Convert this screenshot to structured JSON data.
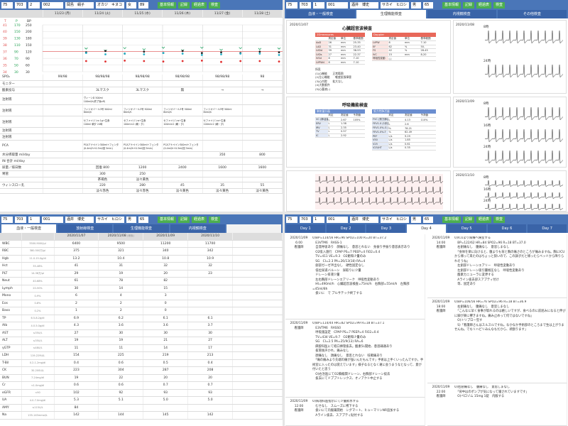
{
  "q1": {
    "pt": [
      "75",
      "703",
      "2",
      "002",
      "岡島　絹子",
      "オカジ　キヌコ",
      "女",
      "89"
    ],
    "btns": [
      "基本情報",
      "記録",
      "経過表",
      "検査"
    ],
    "dates": [
      "11/23 (月)",
      "11/24 (火)",
      "11/25 (水)",
      "11/26 (木)",
      "11/27 (金)",
      "11/28 (土)"
    ],
    "axis": {
      "heads": [
        "T",
        "P",
        "BP"
      ],
      "rows": [
        [
          "41",
          "170",
          "250"
        ],
        [
          "40",
          "150",
          "200"
        ],
        [
          "39",
          "130",
          "180"
        ],
        [
          "38",
          "110",
          "150"
        ],
        [
          "37",
          "90",
          "120"
        ],
        [
          "36",
          "70",
          "90"
        ],
        [
          "35",
          "50",
          "60"
        ],
        [
          "34",
          "30",
          "30"
        ]
      ]
    },
    "vitals": {
      "temp": [
        36.8,
        36.6,
        36.7,
        36.6,
        36.8,
        36.7,
        36.5,
        36.6,
        36.7,
        36.7,
        36.5
      ],
      "pulse": [
        88,
        92,
        84,
        90,
        86,
        92,
        86,
        88,
        86,
        90,
        88
      ],
      "bp_sys": [
        136,
        126,
        138,
        132,
        140,
        128,
        140,
        130,
        138,
        134,
        136
      ],
      "bp_dia": [
        80,
        78,
        82,
        80,
        78,
        80,
        82,
        76,
        80,
        80,
        78
      ]
    },
    "rows": [
      {
        "label": "SPO₂",
        "cells": [
          "99/98",
          "98/98/98",
          "98/98/98",
          "98/98/98",
          "98/98/98",
          "98"
        ]
      },
      {
        "label": "モニター",
        "cells": [
          "",
          "",
          "",
          "",
          "",
          ""
        ]
      },
      {
        "label": "酸素投与",
        "cells": [
          "",
          "3Lマスク",
          "3Lマスク",
          "無",
          "→",
          "→"
        ]
      },
      {
        "label": "注射液",
        "cells": [
          "",
          "ヴィーンD 500ml\n100ml/h(終了後off)",
          "",
          "",
          "",
          ""
        ]
      },
      {
        "label": "注射液",
        "cells": [
          "",
          "フィジオゾール3号 500ml\n80ml/h",
          "フィジオゾール3号 500ml\n80ml/h",
          "フィジオゾール3号 500ml\n80ml/h",
          "フィジオゾール3号 500ml\n80ml/h",
          ""
        ]
      },
      {
        "label": "注射液",
        "cells": [
          "",
          "セファメジンα 1g+生食\n100ml 朝夕 24時",
          "セファメジンα+生食\n100ml×2 (朝・夕)",
          "セファメジンα+生食\n100ml×2 (朝・夕)",
          "セファメジンα+生食\n100ml×2 (朝・夕)",
          ""
        ]
      },
      {
        "label": "注射液",
        "cells": [
          "",
          "",
          "",
          "",
          "",
          ""
        ]
      },
      {
        "label": "注射液",
        "cells": [
          "",
          "",
          "",
          "",
          "",
          ""
        ]
      },
      {
        "label": "PCA",
        "cells": [
          "",
          "PCAアナペイン300ml+フェンタ\n(0.4ml/h+0.3ml/回 5min)",
          "PCAアナペイン300ml+フェンタ\n(0.4ml/h+0.3ml/回 5min)",
          "PCAアナペイン300ml+フェンタ\n(0.4ml/h+0.3ml/回 5min)",
          "",
          ""
        ]
      },
      {
        "label": "水分摂取量 ml/day",
        "cells": [
          "",
          "",
          "",
          "",
          "350",
          "800"
        ]
      },
      {
        "label": "IN 合計 ml/day",
        "cells": [
          "",
          "",
          "",
          "",
          "",
          ""
        ]
      },
      {
        "label": "尿量／排日数",
        "cells": [
          "",
          "回復 800",
          "1200",
          "2400",
          "1600",
          "1600"
        ]
      },
      {
        "label": "胃管",
        "cells": [
          "",
          "300",
          "250",
          "",
          "",
          ""
        ]
      },
      {
        "label": "",
        "cells": [
          "",
          "茶褐色",
          "淡々黄色",
          "",
          "",
          ""
        ]
      },
      {
        "label": "ウィンスロー孔",
        "cells": [
          "",
          "220",
          "280",
          "45",
          "35",
          "55"
        ]
      },
      {
        "label": "",
        "cells": [
          "",
          "淡々赤色",
          "淡々赤色",
          "淡々黄色",
          "淡々黄色",
          "淡々黄色"
        ]
      }
    ]
  },
  "q2": {
    "pt": [
      "75",
      "703",
      "1",
      "001",
      "酒井　博史",
      "サカイ　ヒロシ",
      "男",
      "65"
    ],
    "btns": [
      "基本情報",
      "記録",
      "経過表",
      "検査"
    ],
    "tabs": [
      "血液・一般検査",
      "生理機能検査",
      "内視鏡検査",
      "その他検査"
    ],
    "active_tab": 1,
    "cards": [
      {
        "date": "2020/11/07",
        "title": "心臓超音波検査",
        "left_head": "2Dmeasures",
        "right_head": "Doppler",
        "left_cols": [
          "",
          "測定値",
          "単位",
          "基準範囲"
        ],
        "right_cols": [
          "",
          "測定値",
          "単位",
          "基準範囲"
        ],
        "left": [
          [
            "AoD",
            "26",
            "mm",
            "25-35"
          ],
          [
            "LAD",
            "31",
            "mm",
            "23-40"
          ],
          [
            "LVDd",
            "39",
            "mm",
            "38-53"
          ],
          [
            "LVDs",
            "27",
            "mm",
            "22-37"
          ],
          [
            "IVSd",
            "8",
            "mm",
            "7-10"
          ],
          [
            "LVPWd",
            "8",
            "mm",
            "7-10"
          ]
        ],
        "right": [
          [
            "LVPW",
            "8",
            "mm",
            "7-10"
          ],
          [
            "EF",
            "62",
            "%",
            "50-"
          ],
          [
            "FS",
            "42",
            "%",
            "28-45"
          ],
          [
            "IVC",
            "15",
            "mm",
            "8-20"
          ],
          [
            "呼吸性変動",
            "(-)",
            "",
            ""
          ]
        ],
        "comments": [
          "所見",
          "(1)心機能　　正常範囲",
          "(2)左心機能　　軽度拡張障害",
          "(3)心内腔　　拡大なし",
          "(4)大動脈弁",
          "(5)心嚢液(-)"
        ]
      },
      {
        "date": "",
        "title": "呼吸機能検査",
        "left_head": "肺気量分画",
        "right_head": "努力性肺活量",
        "left_cols": [
          "",
          "判定",
          "測定値",
          "予測値"
        ],
        "right_cols": [
          "",
          "判定",
          "測定値",
          "予測値"
        ],
        "left": [
          [
            "VC (肺活量)",
            "L",
            "2.67",
            "105%"
          ],
          [
            "ERV",
            "L",
            "1.38",
            ""
          ],
          [
            "IRV",
            "L",
            "2.35",
            ""
          ],
          [
            "TV",
            "L",
            "0.57",
            ""
          ],
          [
            "IC",
            "L",
            "2.92",
            ""
          ]
        ],
        "right": [
          [
            "FVC (努力肺活量)",
            "L",
            "4.13",
            "110%"
          ],
          [
            "FEV1.0 (1秒量)",
            "L",
            "2.6",
            ""
          ],
          [
            "FEV1.0%-G (1秒率)",
            "%",
            "78.21",
            ""
          ],
          [
            "FEV1.0%-T",
            "%",
            "62.49",
            ""
          ],
          [
            "PEF",
            "L/s",
            "9.29",
            ""
          ],
          [
            "V50",
            "L/s",
            "1.85",
            ""
          ],
          [
            "V25",
            "L/s",
            "0.61",
            ""
          ],
          [
            "V25/HT",
            "L/s",
            "0.35",
            ""
          ]
        ],
        "comments": []
      },
      {
        "date": "",
        "title": "",
        "left_head": "",
        "right_head": "",
        "left_cols": [],
        "right_cols": [],
        "left": [],
        "right": [],
        "comments": []
      }
    ],
    "ekg": [
      {
        "date": "2020/11/08",
        "labels": [
          "8時",
          "24時"
        ]
      },
      {
        "date": "2020/11/09",
        "labels": [
          "8時",
          "16時",
          "24時"
        ]
      },
      {
        "date": "2020/11/10",
        "labels": [
          "8時",
          "16時",
          "24時"
        ]
      }
    ]
  },
  "q3": {
    "pt": [
      "75",
      "703",
      "1",
      "001",
      "酒井　博史",
      "サカイ　ヒロシ",
      "男",
      "65"
    ],
    "btns": [
      "基本情報",
      "記録",
      "経過表",
      "検査"
    ],
    "tabs": [
      "血液・一般検査",
      "放射線検査",
      "生理機能検査",
      "内視鏡検査"
    ],
    "active_tab": 0,
    "dates": [
      "2020/11/07",
      "2020/11/08",
      "2020/11/09",
      "2020/11/10"
    ],
    "date_note": "(術後)",
    "rows": [
      [
        "WBC",
        "3500-9000/μl",
        "6400",
        "9500",
        "11200",
        "11700"
      ],
      [
        "RBC",
        "380-500万/μl",
        "375",
        "321",
        "340",
        "342"
      ],
      [
        "Hgb",
        "11.0-15.0g/dl",
        "13.2",
        "10.4",
        "10.8",
        "10.9"
      ],
      [
        "Hct",
        "35-48%",
        "41",
        "31",
        "32",
        "32"
      ],
      [
        "PLT",
        "14-38万/μl",
        "29",
        "19",
        "20",
        "23"
      ],
      [
        "Neut",
        "40-68%",
        "61",
        "78",
        "82",
        ""
      ],
      [
        "Lymph",
        "20-50%",
        "30",
        "14",
        "15",
        ""
      ],
      [
        "Mono",
        "0-9%",
        "6",
        "4",
        "3",
        ""
      ],
      [
        "Eos",
        "0-8%",
        "2",
        "2",
        "0",
        ""
      ],
      [
        "Baso",
        "0-2%",
        "1",
        "2",
        "0",
        ""
      ],
      [
        "TP",
        "6.5-8.2g/dl",
        "6.9",
        "6.2",
        "6.1",
        "6.1"
      ],
      [
        "Alb",
        "4.0-5.0g/dl",
        "4.3",
        "3.6",
        "3.6",
        "3.7"
      ],
      [
        "AST",
        "≤35U/L",
        "27",
        "30",
        "30",
        "30"
      ],
      [
        "ALT",
        "≤35U/L",
        "19",
        "19",
        "21",
        "27"
      ],
      [
        "γGTP",
        "≤48U/L",
        "11",
        "11",
        "14",
        "17"
      ],
      [
        "LDH",
        "119-229U/L",
        "154",
        "225",
        "219",
        "213"
      ],
      [
        "T-Bil",
        "0.2-1.2mg/dl",
        "0.4",
        "0.6",
        "0.5",
        "0.4"
      ],
      [
        "CK",
        "30-200U/L",
        "223",
        "304",
        "287",
        "208"
      ],
      [
        "BUN",
        "7-24mg/dl",
        "19",
        "22",
        "20",
        "20"
      ],
      [
        "Cr",
        "<1.0mg/dl",
        "0.6",
        "0.6",
        "0.7",
        "0.7"
      ],
      [
        "eGFR",
        "<90",
        "102",
        "92",
        "93",
        "93"
      ],
      [
        "UA",
        "4.0-7.0mg/dl",
        "5.3",
        "5.1",
        "5.0",
        "5.0"
      ],
      [
        "AMY",
        "≤115U/L",
        "84",
        "",
        "",
        ""
      ],
      [
        "Na",
        "135-145mmol/L",
        "142",
        "144",
        "145",
        "142"
      ]
    ]
  },
  "q4": {
    "pt": [
      "75",
      "703",
      "1",
      "001",
      "酒井　博史",
      "サカイ　ヒロシ",
      "男",
      "65"
    ],
    "btns": [
      "基本情報",
      "記録",
      "経過表",
      "検査"
    ],
    "days": [
      "Day 1",
      "Day 2",
      "Day 3",
      "Day 4",
      "Day 5",
      "Day 6",
      "Day 7"
    ],
    "active_day": 3,
    "left": [
      {
        "date": "2020/11/09",
        "time": "6:00",
        "role": "看護師",
        "text": "O)BP=114/56 HR=96 SPO2=100 R=20 BT=37.2\n　E3VTM6　RASS-1\n　自発呼吸あり　顔痛なし　意思とれない　身振り手振り意思表示あり\n　O2吸入施行　CPAP PS=7 PEEP=4 FiO2=0.4\n　TV=411 VE=9.3　O2飽和少量のみ\n　SG　CI=2.3 PA=26/13(18) RA=4\n　創部ガーゼ滲出なし　硬性固定なし\n　低位尿道バルーン　尿取りに少量\n　ドレーン排液少量\n　左右胸部ドレーンエアリーク　呼吸性変動あり\n　Ht=490ml/h　心臓超音波検査=75ml/h　右胸部=55ml/h　左胸部=45ml/8h\n　扱いに　で プルサテック終了する"
      },
      {
        "date": "2020/11/09",
        "time": "",
        "role": "看護師",
        "text": "O)BP=114/44 HR=82 SPO2=99 R=18 BT=37.1\n　E3VTM6　RASS0\n　呼吸施設定　CPAP PS=7 PEEP=4 FiO2=0.4\n　TV=434 VE=9.7　O2飽和少量のみ\n　SG　CI=2.5 PA=25/9(13) RA=6\n　麻酔科医にて経口挿管抜去。酸素5L開始、意思疎通あり\n　抜管後声かれ、痛みなし\n　顔痛なし　顔痛なし　意思とれない　咳嗽痛あり\n　「痛の痛みより先端の痛が強いんだもんです」手術は上手くいったんですか。手術室に入ったのは覚えています」様子なるとなく運に会うまうなとなって、意が付いたと思う\n　O)右治医にてO2蘇級関ドレーン、右胸部ドレーン抜去\n　抜去にてドプブトレックス、オノアクト中止する"
      },
      {
        "date": "2020/11/09",
        "time": "12:00",
        "role": "看護師",
        "text": "O)病理科医指示にて少量飲水する\n　むせなし　スムーズに嚥下する\n　扱いにて内服薬開始　シグマート、ヒューマリンNR追加する\n　Aライン抜去、スアプティ貼付する"
      }
    ],
    "right": [
      {
        "date": "2020/11/09",
        "time": "14:00",
        "role": "看護師",
        "text": "O)ICUより病棟へ帰室する\n　BP=122/62 HR=84 SPO2=96 R=18 BT=37.0\n　右創痛なし　腹痛なし　意思しまなし\n　「身体を楽に向けると、腹よりも背と胸の痛さのところが痛みますね。胸にICUから帰って来たのはちょっと狭いので、この調子だと帰ったらベッドから降りられそうね」\n　左創部ドレーンエアリー　呼吸性変動あり\n　左創部ドレーン吸引量極圧なし　呼吸性変動あり\n　酸素カニューラに変更する\n　Aライン抜去部スアプティ付け\n　等、固定あり"
      },
      {
        "date": "2020/11/09",
        "time": "18:00",
        "role": "看護師",
        "text": "O)BP=106/56 HR=76 SPO2=96 R=18 BT=36.9\n　右創痛なし　腹痛なし　意思しまなし\n　「こんなに早く食事が取れるのは嬉しいですが、食べるのに前屈みになると伸びに脚が楽に響きますね。痛み止めって何ではないですね」\n　O)トリプロー型す\n　S)「看護師さんはスルスルですね。なかなか手術部のところまで生は上がりませんね。でもリハビリみんなもだから、頑張ります」"
      },
      {
        "date": "2020/11/09",
        "time": "22:00",
        "role": "看護師",
        "text": "O)右創痛なし　腹痛なし　意思しまなし\n　「背中はのポンプが気になって寝されていますです」\n　O)ペロゾム 15mg 1錠　内服する"
      }
    ]
  }
}
